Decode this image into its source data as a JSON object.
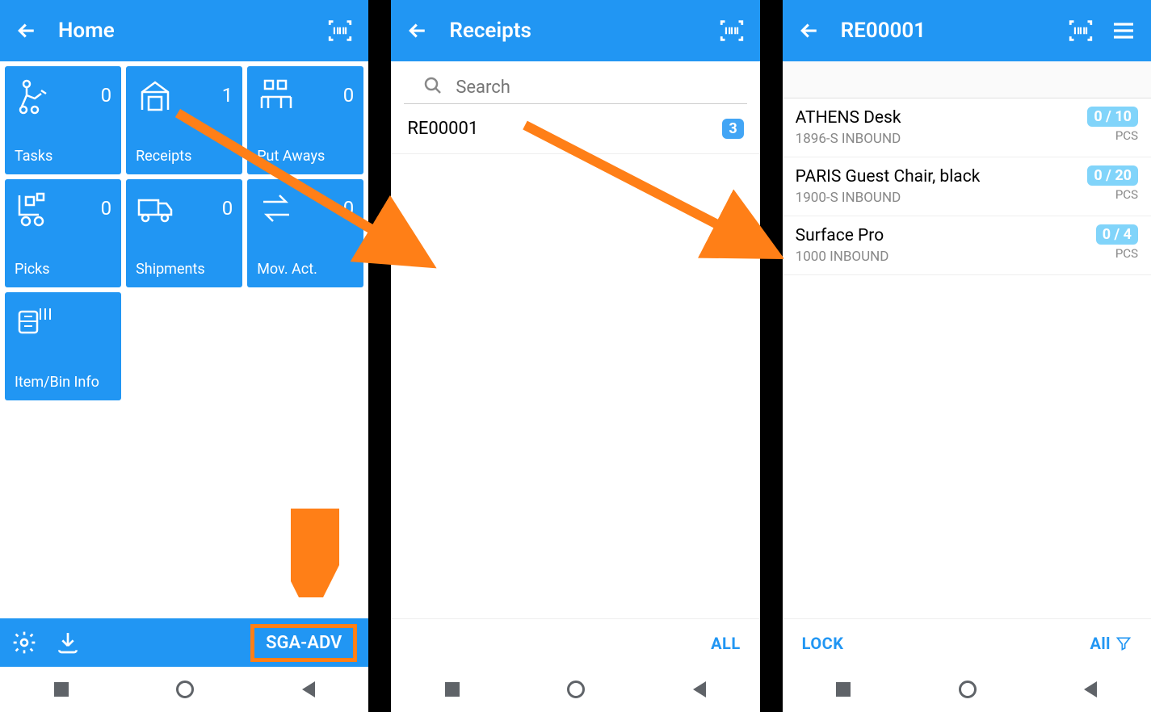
{
  "colors": {
    "primary": "#2196f3",
    "accent": "#ff7f17",
    "badge": "#42a5f5"
  },
  "screen1": {
    "title": "Home",
    "tiles": [
      {
        "label": "Tasks",
        "count": 0,
        "icon": "tasks"
      },
      {
        "label": "Receipts",
        "count": 1,
        "icon": "receipts"
      },
      {
        "label": "Put Aways",
        "count": 0,
        "icon": "putaways"
      },
      {
        "label": "Picks",
        "count": 0,
        "icon": "picks"
      },
      {
        "label": "Shipments",
        "count": 0,
        "icon": "shipments"
      },
      {
        "label": "Mov. Act.",
        "count": 0,
        "icon": "movact"
      },
      {
        "label": "Item/Bin Info",
        "count": "",
        "icon": "iteminfo"
      }
    ],
    "footer_button": "SGA-ADV"
  },
  "screen2": {
    "title": "Receipts",
    "search_placeholder": "Search",
    "rows": [
      {
        "id": "RE00001",
        "badge": 3
      }
    ],
    "bottom_action": "ALL"
  },
  "screen3": {
    "title": "RE00001",
    "items": [
      {
        "name": "ATHENS Desk",
        "code": "1896-S INBOUND",
        "qty": "0 / 10",
        "unit": "PCS"
      },
      {
        "name": "PARIS Guest Chair, black",
        "code": "1900-S INBOUND",
        "qty": "0 / 20",
        "unit": "PCS"
      },
      {
        "name": "Surface Pro",
        "code": "1000 INBOUND",
        "qty": "0 / 4",
        "unit": "PCS"
      }
    ],
    "lock_label": "LOCK",
    "filter_label": "All"
  }
}
